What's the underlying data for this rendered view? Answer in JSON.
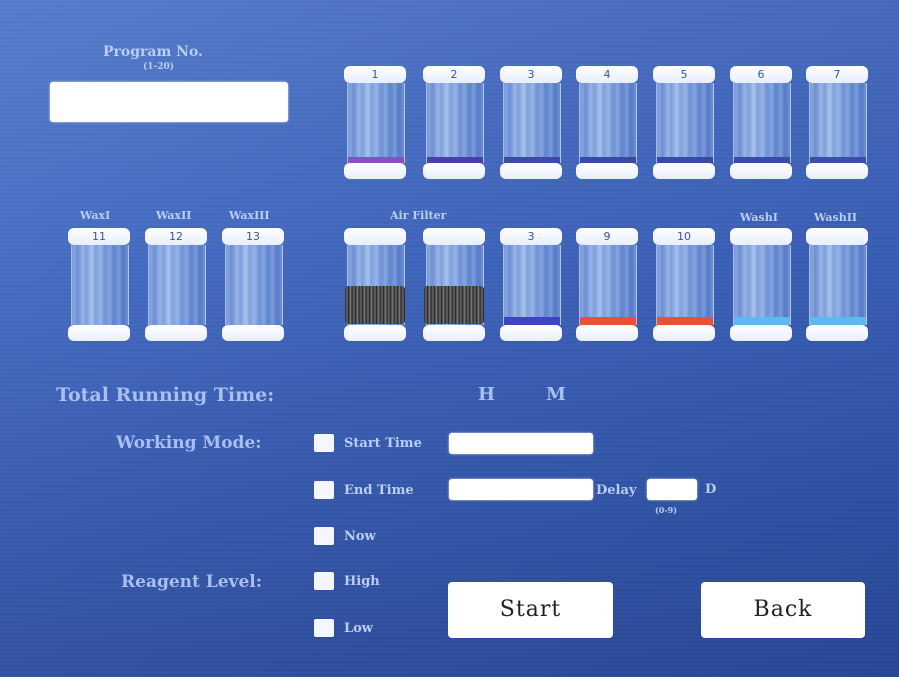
{
  "program": {
    "title": "Program No.",
    "range": "(1-20)",
    "value": ""
  },
  "top_bottles": [
    {
      "number": "1",
      "liquid": "#8b4fc4"
    },
    {
      "number": "2",
      "liquid": "#4a3fa8"
    },
    {
      "number": "3",
      "liquid": "#3e4aa8"
    },
    {
      "number": "4",
      "liquid": "#3a48a6"
    },
    {
      "number": "5",
      "liquid": "#3a4aa8"
    },
    {
      "number": "6",
      "liquid": "#3a4aa8"
    },
    {
      "number": "7",
      "liquid": "#3d4eaa"
    }
  ],
  "wax_labels": {
    "wax1": "WaxI",
    "wax2": "WaxII",
    "wax3": "WaxIII"
  },
  "wax_bottles": [
    {
      "number": "11"
    },
    {
      "number": "12"
    },
    {
      "number": "13"
    }
  ],
  "air_filter_label": "Air Filter",
  "wash_labels": {
    "wash1": "WashI",
    "wash2": "WashII"
  },
  "lower_bottles": [
    {
      "number": "",
      "liquid": "#555555"
    },
    {
      "number": "",
      "liquid": "#555555"
    },
    {
      "number": "3",
      "liquid": "#3f45c0"
    },
    {
      "number": "9",
      "liquid": "#e8503a"
    },
    {
      "number": "10",
      "liquid": "#e8503a"
    },
    {
      "number": "",
      "liquid": "#5fb8f0"
    },
    {
      "number": "",
      "liquid": "#5fb8f0"
    }
  ],
  "running_time": {
    "label": "Total Running Time:",
    "hours_unit": "H",
    "minutes_unit": "M"
  },
  "working_mode": {
    "label": "Working Mode:",
    "start_time": "Start Time",
    "end_time": "End Time",
    "delay": "Delay",
    "delay_unit": "D",
    "delay_range": "(0-9)",
    "now": "Now"
  },
  "reagent_level": {
    "label": "Reagent Level:",
    "high": "High",
    "low": "Low"
  },
  "buttons": {
    "start": "Start",
    "back": "Back"
  }
}
